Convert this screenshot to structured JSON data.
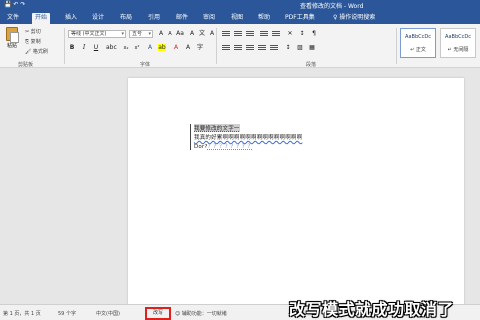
{
  "titlebar": {
    "quick_access": "💾  ↶  ↷",
    "title": "查看修改的文档 - Word"
  },
  "tabs": [
    {
      "label": "文件"
    },
    {
      "label": "开始",
      "active": true
    },
    {
      "label": "插入"
    },
    {
      "label": "设计"
    },
    {
      "label": "布局"
    },
    {
      "label": "引用"
    },
    {
      "label": "邮件"
    },
    {
      "label": "审阅"
    },
    {
      "label": "视图"
    },
    {
      "label": "帮助"
    },
    {
      "label": "PDF工具集"
    },
    {
      "label": "♀  操作说明搜索"
    }
  ],
  "ribbon": {
    "clipboard": {
      "paste_label": "粘贴",
      "cut_label": "✂ 剪切",
      "copy_label": "⎘ 复制",
      "format_painter_label": "🖌 格式刷",
      "group_label": "剪贴板"
    },
    "font": {
      "font_name": "等线 (中文正文)",
      "font_size": "五号",
      "group_label": "字体"
    },
    "paragraph": {
      "group_label": "段落"
    },
    "styles": {
      "items": [
        {
          "sample": "AaBbCcDc",
          "name": "↵ 正文"
        },
        {
          "sample": "AaBbCcDc",
          "name": "↵ 无间隔"
        }
      ]
    }
  },
  "document": {
    "line1": "我要修改的文字一",
    "line2": "我真的好累啊啊啊啊啊啊啊啊啊啊啊啊啊啊",
    "line3_start": "Dor?",
    "line3_rest": "？？？？？？？？"
  },
  "statusbar": {
    "page": "第 1 页，共 1 页",
    "words": "59 个字",
    "language": "中文(中国)",
    "overtype": "改写",
    "accessibility": "☺ 辅助功能：一切就绪"
  },
  "caption": "改写模式就成功取消了",
  "colors": {
    "brand": "#2b579a",
    "highlight_box": "#e0201c"
  }
}
